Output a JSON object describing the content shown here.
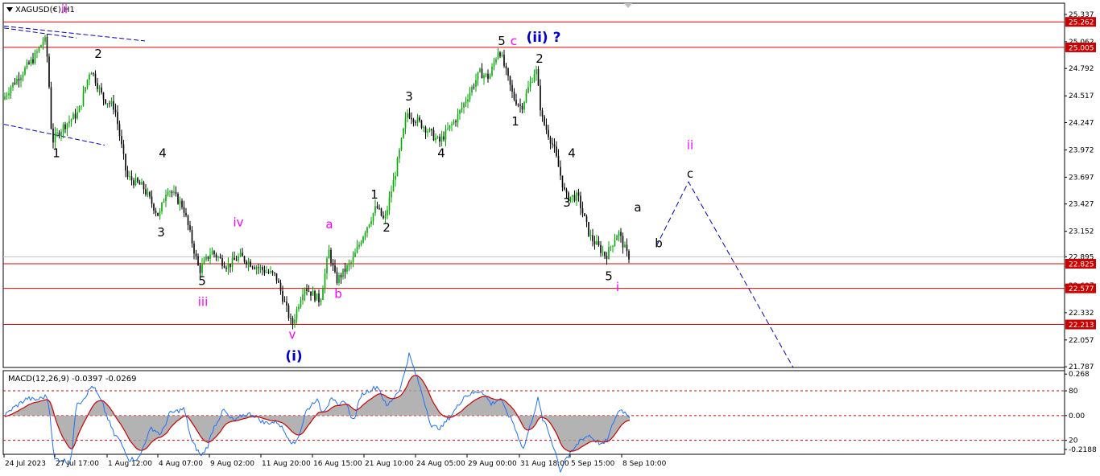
{
  "header": {
    "symbol": "XAGUSD(€),H1",
    "macd_label": "MACD(12,26,9) -0.0397 -0.0269"
  },
  "colors": {
    "up_candle": "#00aa00",
    "down_candle": "#000000",
    "level_line": "#e00000",
    "wave_black": "#000000",
    "wave_magenta": "#ff00ff",
    "wave_blue": "#0000cc",
    "projection": "#0000cc",
    "macd_hist": "#a0a0a0",
    "macd_main": "#1e6fff",
    "macd_signal": "#cc0000",
    "badge_fill": "#cc0000"
  },
  "chart_data": [
    {
      "type": "candlestick",
      "symbol": "XAGUSD(€)",
      "timeframe": "H1",
      "ylim": [
        21.78,
        25.45
      ],
      "y_ticks": [
        "25.337",
        "25.062",
        "24.792",
        "24.517",
        "24.247",
        "23.972",
        "23.697",
        "23.427",
        "23.152",
        "22.895",
        "22.607",
        "22.332",
        "22.057",
        "21.787"
      ],
      "x_ticks": [
        "24 Jul 2023",
        "27 Jul 17:00",
        "1 Aug 12:00",
        "4 Aug 07:00",
        "9 Aug 02:00",
        "11 Aug 20:00",
        "16 Aug 15:00",
        "21 Aug 10:00",
        "24 Aug 05:00",
        "29 Aug 00:00",
        "31 Aug 18:00",
        "5 Sep 15:00",
        "8 Sep 10:00"
      ],
      "price_path": [
        [
          0,
          24.4
        ],
        [
          15,
          24.6
        ],
        [
          30,
          24.75
        ],
        [
          45,
          24.9
        ],
        [
          58,
          25.1
        ],
        [
          62,
          24.85
        ],
        [
          67,
          24.05
        ],
        [
          80,
          24.2
        ],
        [
          100,
          24.35
        ],
        [
          115,
          24.8
        ],
        [
          130,
          24.5
        ],
        [
          145,
          24.4
        ],
        [
          160,
          23.7
        ],
        [
          180,
          23.6
        ],
        [
          200,
          23.3
        ],
        [
          210,
          23.6
        ],
        [
          230,
          23.4
        ],
        [
          250,
          22.75
        ],
        [
          265,
          22.95
        ],
        [
          285,
          22.8
        ],
        [
          300,
          22.9
        ],
        [
          320,
          22.8
        ],
        [
          345,
          22.7
        ],
        [
          365,
          22.2
        ],
        [
          380,
          22.6
        ],
        [
          400,
          22.45
        ],
        [
          411,
          22.95
        ],
        [
          420,
          22.65
        ],
        [
          440,
          22.85
        ],
        [
          455,
          23.15
        ],
        [
          470,
          23.4
        ],
        [
          480,
          23.25
        ],
        [
          495,
          23.8
        ],
        [
          508,
          24.35
        ],
        [
          530,
          24.2
        ],
        [
          548,
          24.05
        ],
        [
          570,
          24.3
        ],
        [
          598,
          24.75
        ],
        [
          610,
          24.7
        ],
        [
          622,
          25.0
        ],
        [
          640,
          24.5
        ],
        [
          650,
          24.4
        ],
        [
          668,
          24.8
        ],
        [
          675,
          24.3
        ],
        [
          690,
          24.0
        ],
        [
          705,
          23.5
        ],
        [
          720,
          23.5
        ],
        [
          735,
          23.1
        ],
        [
          755,
          22.9
        ],
        [
          770,
          23.15
        ],
        [
          782,
          22.9
        ]
      ],
      "levels": [
        {
          "label": "25.262",
          "value": 25.262
        },
        {
          "label": "25.005",
          "value": 25.005
        },
        {
          "label": "22.825",
          "value": 22.825
        },
        {
          "label": "22.577",
          "value": 22.577
        },
        {
          "label": "22.213",
          "value": 22.213
        }
      ],
      "current_price": {
        "label": "22.895",
        "value": 22.895
      },
      "wave_labels": [
        {
          "text": "ii",
          "color": "magenta",
          "x": 80,
          "y": 25.35
        },
        {
          "text": "1",
          "color": "black",
          "x": 70,
          "y": 23.9
        },
        {
          "text": "2",
          "color": "black",
          "x": 122,
          "y": 24.9
        },
        {
          "text": "4",
          "color": "black",
          "x": 202,
          "y": 23.9
        },
        {
          "text": "3",
          "color": "black",
          "x": 200,
          "y": 23.1
        },
        {
          "text": "iv",
          "color": "magenta",
          "x": 296,
          "y": 23.2
        },
        {
          "text": "5",
          "color": "black",
          "x": 251,
          "y": 22.61
        },
        {
          "text": "iii",
          "color": "magenta",
          "x": 252,
          "y": 22.4
        },
        {
          "text": "a",
          "color": "magenta",
          "x": 409,
          "y": 23.18
        },
        {
          "text": "b",
          "color": "magenta",
          "x": 420,
          "y": 22.48
        },
        {
          "text": "v",
          "color": "magenta",
          "x": 363,
          "y": 22.07
        },
        {
          "text": "(i)",
          "color": "blue",
          "x": 365,
          "y": 21.85
        },
        {
          "text": "1",
          "color": "black",
          "x": 465,
          "y": 23.48
        },
        {
          "text": "2",
          "color": "black",
          "x": 480,
          "y": 23.15
        },
        {
          "text": "3",
          "color": "black",
          "x": 508,
          "y": 24.47
        },
        {
          "text": "4",
          "color": "black",
          "x": 548,
          "y": 23.9
        },
        {
          "text": "5",
          "color": "black",
          "x": 623,
          "y": 25.03
        },
        {
          "text": "c",
          "color": "magenta",
          "x": 638,
          "y": 25.03
        },
        {
          "text": "(ii) ?",
          "color": "blue",
          "x": 675,
          "y": 25.06
        },
        {
          "text": "2",
          "color": "black",
          "x": 670,
          "y": 24.85
        },
        {
          "text": "1",
          "color": "black",
          "x": 640,
          "y": 24.22
        },
        {
          "text": "4",
          "color": "black",
          "x": 710,
          "y": 23.9
        },
        {
          "text": "3",
          "color": "black",
          "x": 704,
          "y": 23.4
        },
        {
          "text": "a",
          "color": "black",
          "x": 792,
          "y": 23.35
        },
        {
          "text": "5",
          "color": "black",
          "x": 756,
          "y": 22.66
        },
        {
          "text": "i",
          "color": "magenta",
          "x": 767,
          "y": 22.55
        },
        {
          "text": "b",
          "color": "black",
          "x": 818,
          "y": 22.99
        },
        {
          "text": "ii",
          "color": "magenta",
          "x": 857,
          "y": 23.98
        },
        {
          "text": "c",
          "color": "black",
          "x": 857,
          "y": 23.69
        }
      ],
      "projection": [
        [
          815,
          23.0
        ],
        [
          855,
          23.65
        ],
        [
          985,
          21.78
        ]
      ],
      "channel_lines": [
        {
          "from": [
            5,
            25.22
          ],
          "to": [
            180,
            25.07
          ]
        },
        {
          "from": [
            5,
            25.2
          ],
          "to": [
            95,
            25.1
          ]
        },
        {
          "from": [
            5,
            24.23
          ],
          "to": [
            130,
            24.02
          ]
        }
      ]
    },
    {
      "type": "line",
      "name": "MACD(12,26,9)",
      "main": -0.0397,
      "signal": -0.0269,
      "ylim": [
        -0.25,
        0.29
      ],
      "y_ticks": [
        "0.268",
        "80",
        "0.00",
        "20",
        "-0.2188"
      ],
      "level_lines": [
        0.16,
        0.0,
        -0.16
      ]
    }
  ]
}
